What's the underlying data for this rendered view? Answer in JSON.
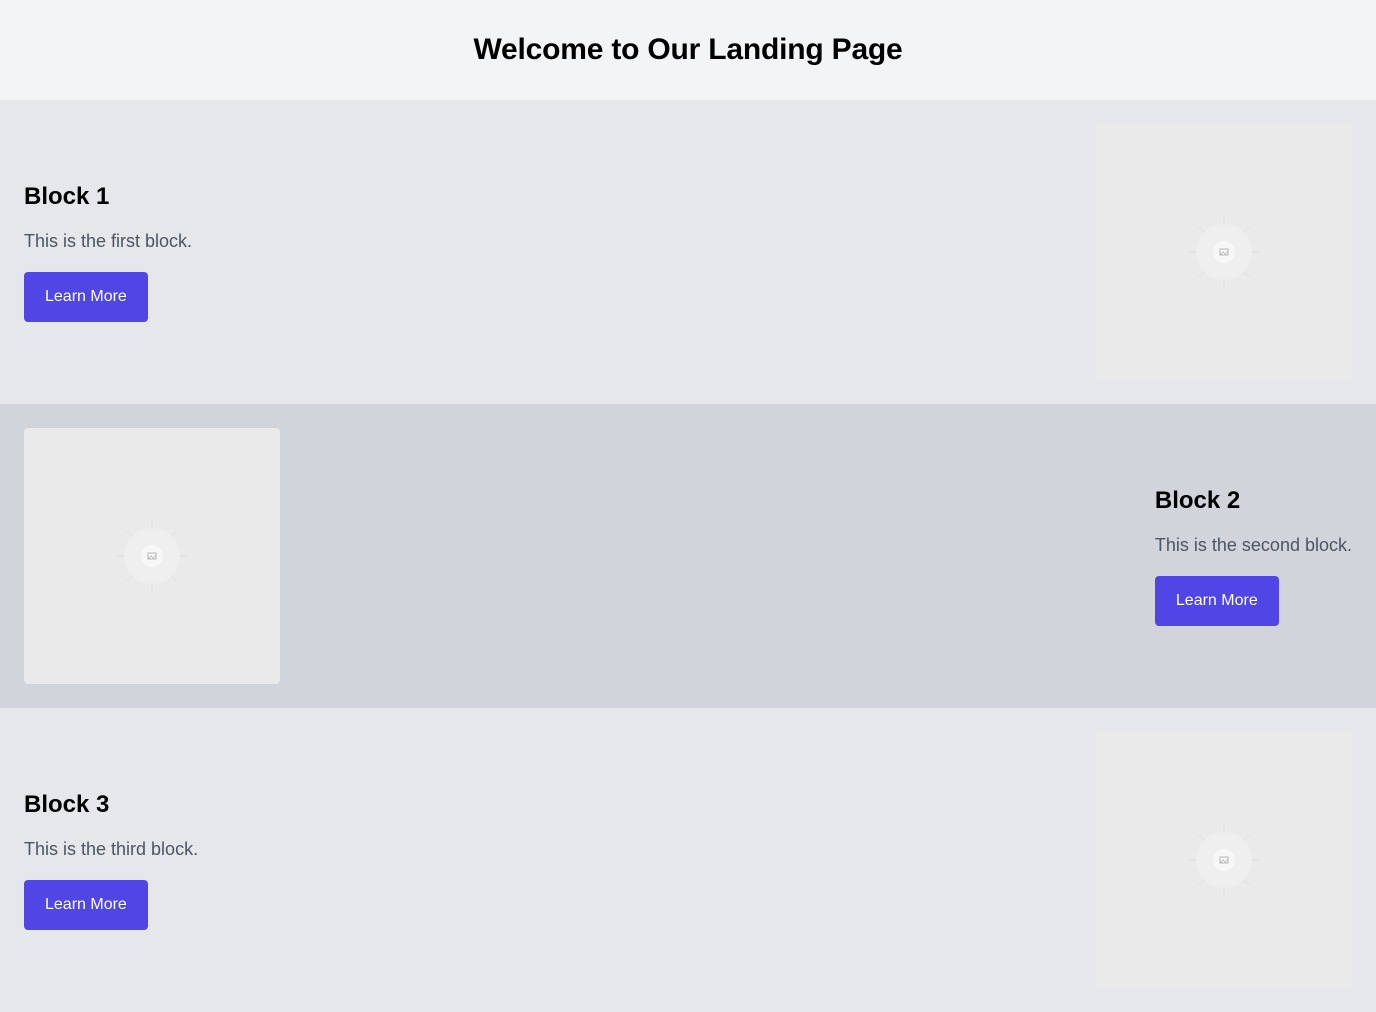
{
  "header": {
    "title": "Welcome to Our Landing Page"
  },
  "blocks": [
    {
      "title": "Block 1",
      "description": "This is the first block.",
      "button_label": "Learn More",
      "image_icon": "image-placeholder-icon"
    },
    {
      "title": "Block 2",
      "description": "This is the second block.",
      "button_label": "Learn More",
      "image_icon": "image-placeholder-icon"
    },
    {
      "title": "Block 3",
      "description": "This is the third block.",
      "button_label": "Learn More",
      "image_icon": "image-placeholder-icon"
    }
  ],
  "colors": {
    "accent": "#4f46e5",
    "header_bg": "#f3f4f6",
    "block_light_bg": "#e5e7eb",
    "block_dark_bg": "#d1d5db",
    "image_bg": "#eaeaea"
  }
}
